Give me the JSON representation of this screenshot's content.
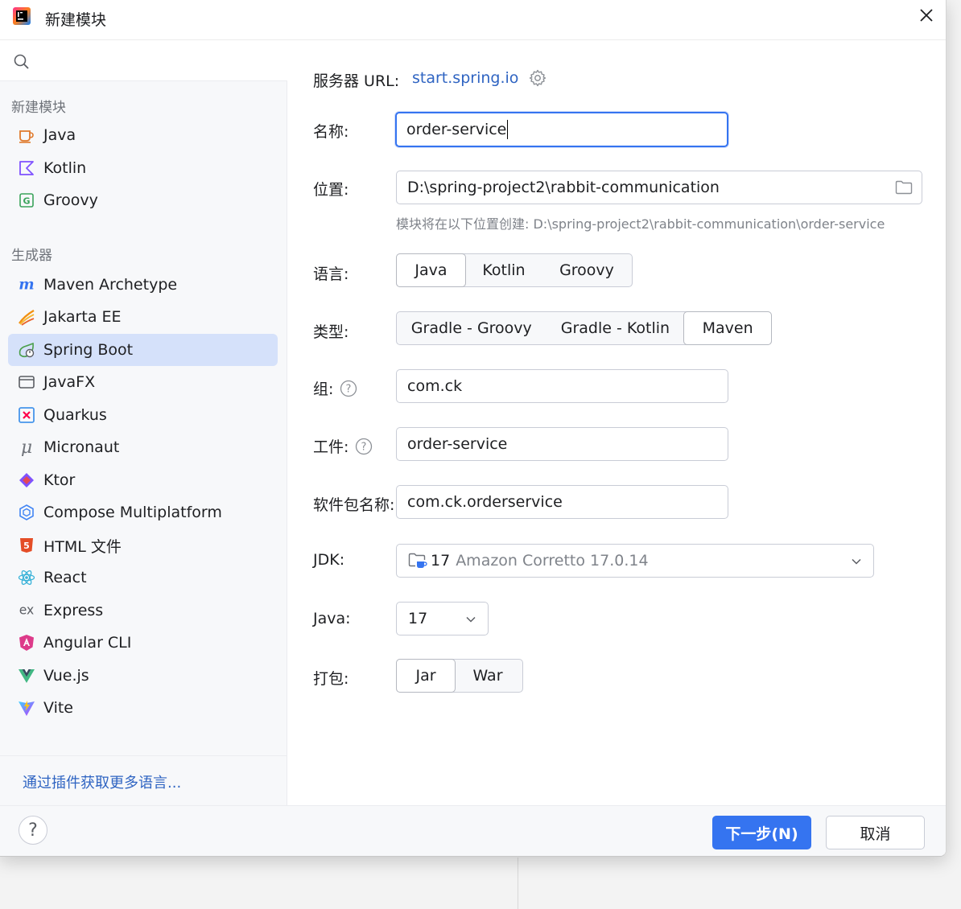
{
  "window": {
    "title": "新建模块"
  },
  "search": {
    "placeholder": ""
  },
  "sidebar": {
    "section_languages": "新建模块",
    "languages": [
      {
        "label": "Java",
        "icon": "java-icon"
      },
      {
        "label": "Kotlin",
        "icon": "kotlin-icon"
      },
      {
        "label": "Groovy",
        "icon": "groovy-icon"
      }
    ],
    "section_generators": "生成器",
    "generators": [
      {
        "label": "Maven Archetype",
        "icon": "maven-icon"
      },
      {
        "label": "Jakarta EE",
        "icon": "jakarta-icon"
      },
      {
        "label": "Spring Boot",
        "icon": "spring-boot-icon",
        "selected": true
      },
      {
        "label": "JavaFX",
        "icon": "javafx-icon"
      },
      {
        "label": "Quarkus",
        "icon": "quarkus-icon"
      },
      {
        "label": "Micronaut",
        "icon": "micronaut-icon"
      },
      {
        "label": "Ktor",
        "icon": "ktor-icon"
      },
      {
        "label": "Compose Multiplatform",
        "icon": "compose-icon"
      },
      {
        "label": "HTML 文件",
        "icon": "html5-icon"
      },
      {
        "label": "React",
        "icon": "react-icon"
      },
      {
        "label": "Express",
        "icon": "express-icon"
      },
      {
        "label": "Angular CLI",
        "icon": "angular-icon"
      },
      {
        "label": "Vue.js",
        "icon": "vue-icon"
      },
      {
        "label": "Vite",
        "icon": "vite-icon"
      }
    ],
    "more_link": "通过插件获取更多语言..."
  },
  "form": {
    "server_label": "服务器 URL:",
    "server_url": "start.spring.io",
    "name_label": "名称:",
    "name_value": "order-service",
    "location_label": "位置:",
    "location_value": "D:\\spring-project2\\rabbit-communication",
    "location_hint": "模块将在以下位置创建: D:\\spring-project2\\rabbit-communication\\order-service",
    "language_label": "语言:",
    "language_options": [
      "Java",
      "Kotlin",
      "Groovy"
    ],
    "language_selected": "Java",
    "type_label": "类型:",
    "type_options": [
      "Gradle - Groovy",
      "Gradle - Kotlin",
      "Maven"
    ],
    "type_selected": "Maven",
    "group_label": "组:",
    "group_value": "com.ck",
    "artifact_label": "工件:",
    "artifact_value": "order-service",
    "package_label": "软件包名称:",
    "package_value": "com.ck.orderservice",
    "jdk_label": "JDK:",
    "jdk_version": "17",
    "jdk_name": "Amazon Corretto 17.0.14",
    "java_label": "Java:",
    "java_value": "17",
    "packaging_label": "打包:",
    "packaging_options": [
      "Jar",
      "War"
    ],
    "packaging_selected": "Jar"
  },
  "footer": {
    "help_glyph": "?",
    "next_button": "下一步(N)",
    "cancel_button": "取消"
  },
  "colors": {
    "accent": "#3574f0",
    "link": "#2f64c2",
    "selection": "#d5e1fa"
  }
}
